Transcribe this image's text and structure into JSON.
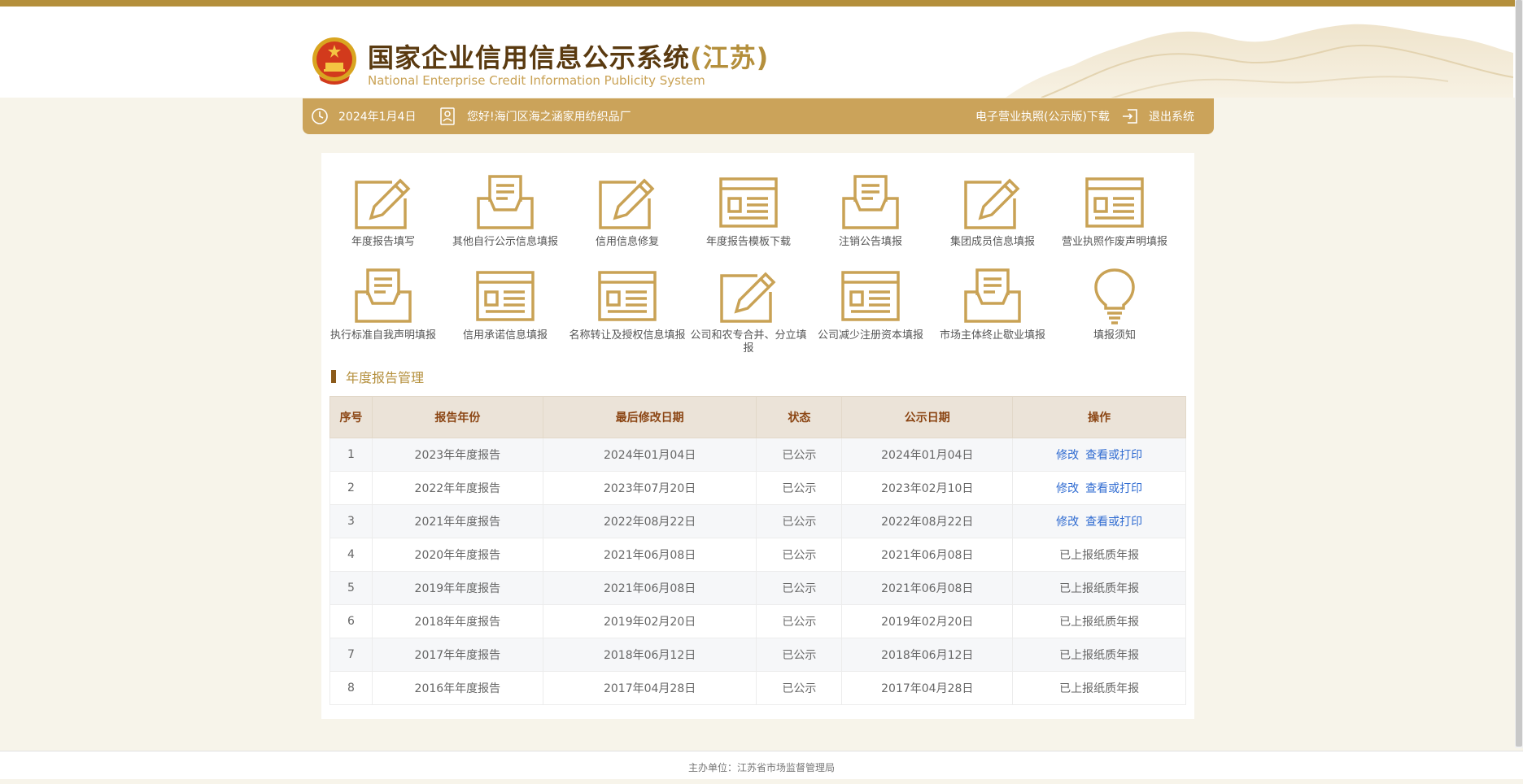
{
  "header": {
    "title_main": "国家企业信用信息公示系统",
    "title_province": "(江苏)",
    "subtitle": "National Enterprise Credit Information Publicity System",
    "emblem_icon": "national-emblem-icon",
    "accent_color": "#b48f3c"
  },
  "navbar": {
    "date": "2024年1月4日",
    "greeting": "您好!海门区海之涵家用纺织品厂",
    "license_download": "电子营业执照(公示版)下载",
    "logout": "退出系统",
    "background_color": "#cba35a"
  },
  "functions": [
    {
      "label": "年度报告填写",
      "icon": "edit-form-icon"
    },
    {
      "label": "其他自行公示信息填报",
      "icon": "inbox-document-icon"
    },
    {
      "label": "信用信息修复",
      "icon": "edit-form-icon"
    },
    {
      "label": "年度报告模板下载",
      "icon": "template-window-icon"
    },
    {
      "label": "注销公告填报",
      "icon": "inbox-document-icon"
    },
    {
      "label": "集团成员信息填报",
      "icon": "edit-form-icon"
    },
    {
      "label": "营业执照作废声明填报",
      "icon": "template-window-icon"
    },
    {
      "label": "执行标准自我声明填报",
      "icon": "inbox-document-icon"
    },
    {
      "label": "信用承诺信息填报",
      "icon": "template-window-icon"
    },
    {
      "label": "名称转让及授权信息填报",
      "icon": "template-window-icon"
    },
    {
      "label": "公司和农专合并、分立填报",
      "icon": "edit-form-icon"
    },
    {
      "label": "公司减少注册资本填报",
      "icon": "template-window-icon"
    },
    {
      "label": "市场主体终止歇业填报",
      "icon": "inbox-document-icon"
    },
    {
      "label": "填报须知",
      "icon": "lightbulb-icon"
    }
  ],
  "section": {
    "title": "年度报告管理"
  },
  "table": {
    "headers": [
      "序号",
      "报告年份",
      "最后修改日期",
      "状态",
      "公示日期",
      "操作"
    ],
    "rows": [
      {
        "no": "1",
        "year": "2023年年度报告",
        "modified": "2024年01月04日",
        "status": "已公示",
        "published": "2024年01月04日",
        "op_edit": "修改",
        "op_view": "查看或打印",
        "op_text": ""
      },
      {
        "no": "2",
        "year": "2022年年度报告",
        "modified": "2023年07月20日",
        "status": "已公示",
        "published": "2023年02月10日",
        "op_edit": "修改",
        "op_view": "查看或打印",
        "op_text": ""
      },
      {
        "no": "3",
        "year": "2021年年度报告",
        "modified": "2022年08月22日",
        "status": "已公示",
        "published": "2022年08月22日",
        "op_edit": "修改",
        "op_view": "查看或打印",
        "op_text": ""
      },
      {
        "no": "4",
        "year": "2020年年度报告",
        "modified": "2021年06月08日",
        "status": "已公示",
        "published": "2021年06月08日",
        "op_edit": "",
        "op_view": "",
        "op_text": "已上报纸质年报"
      },
      {
        "no": "5",
        "year": "2019年年度报告",
        "modified": "2021年06月08日",
        "status": "已公示",
        "published": "2021年06月08日",
        "op_edit": "",
        "op_view": "",
        "op_text": "已上报纸质年报"
      },
      {
        "no": "6",
        "year": "2018年年度报告",
        "modified": "2019年02月20日",
        "status": "已公示",
        "published": "2019年02月20日",
        "op_edit": "",
        "op_view": "",
        "op_text": "已上报纸质年报"
      },
      {
        "no": "7",
        "year": "2017年年度报告",
        "modified": "2018年06月12日",
        "status": "已公示",
        "published": "2018年06月12日",
        "op_edit": "",
        "op_view": "",
        "op_text": "已上报纸质年报"
      },
      {
        "no": "8",
        "year": "2016年年度报告",
        "modified": "2017年04月28日",
        "status": "已公示",
        "published": "2017年04月28日",
        "op_edit": "",
        "op_view": "",
        "op_text": "已上报纸质年报"
      }
    ]
  },
  "footer": {
    "text": "主办单位：江苏省市场监督管理局"
  }
}
